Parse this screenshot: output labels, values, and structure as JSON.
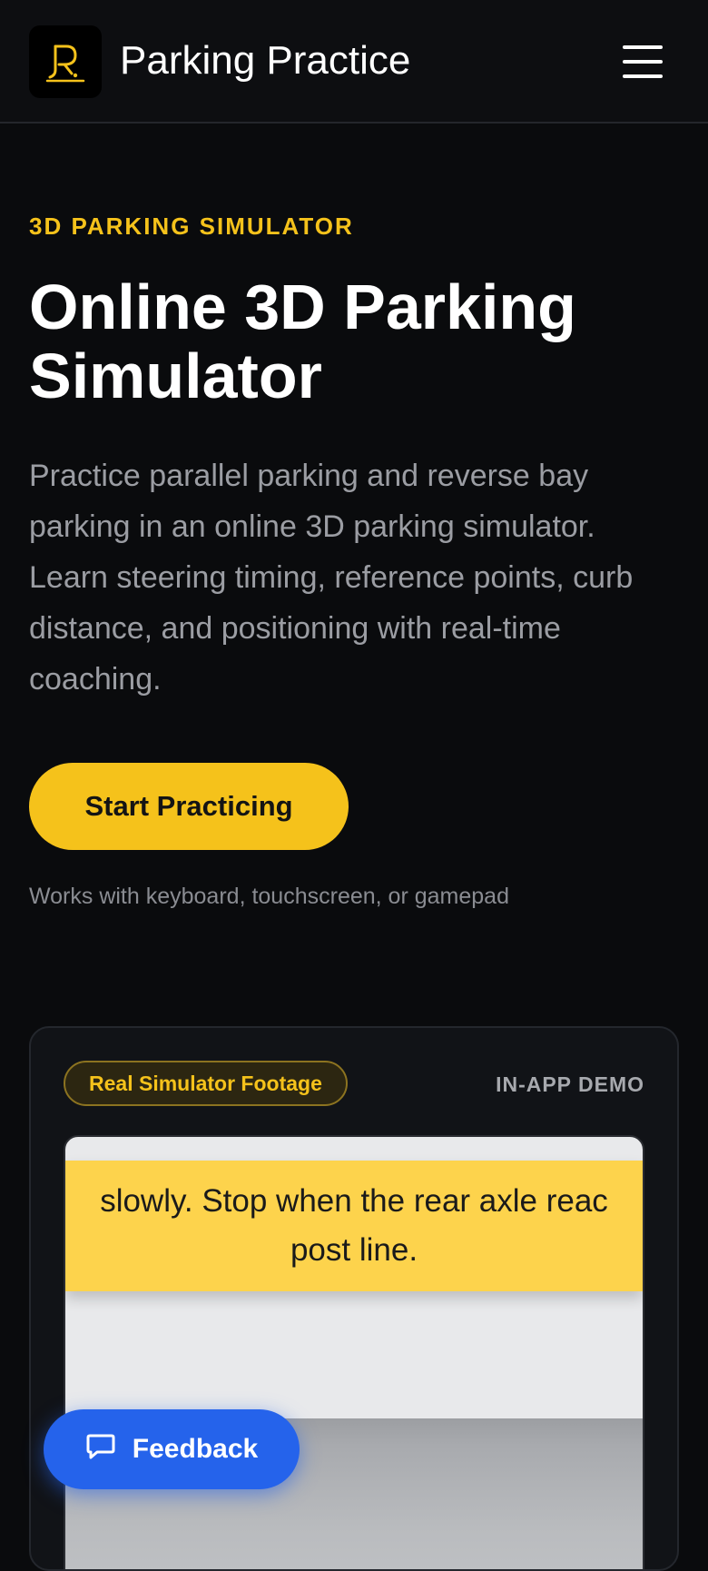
{
  "header": {
    "brand": "Parking Practice",
    "logo_icon": "parking-logo-icon",
    "menu_icon": "hamburger-menu-icon"
  },
  "hero": {
    "eyebrow": "3D PARKING SIMULATOR",
    "title": "Online 3D Parking Simulator",
    "description": "Practice parallel parking and reverse bay parking in an online 3D parking simulator. Learn steering timing, reference points, curb distance, and positioning with real-time coaching.",
    "cta_label": "Start Practicing",
    "hint": "Works with keyboard, touchscreen, or gamepad"
  },
  "demo": {
    "badge": "Real Simulator Footage",
    "label": "IN-APP DEMO",
    "banner_line1": "slowly. Stop when the rear axle reac",
    "banner_line2": "post line."
  },
  "feedback": {
    "label": "Feedback",
    "icon": "chat-bubble-icon"
  },
  "colors": {
    "background": "#0a0b0d",
    "accent": "#f5c21b",
    "feedback": "#2563eb"
  }
}
